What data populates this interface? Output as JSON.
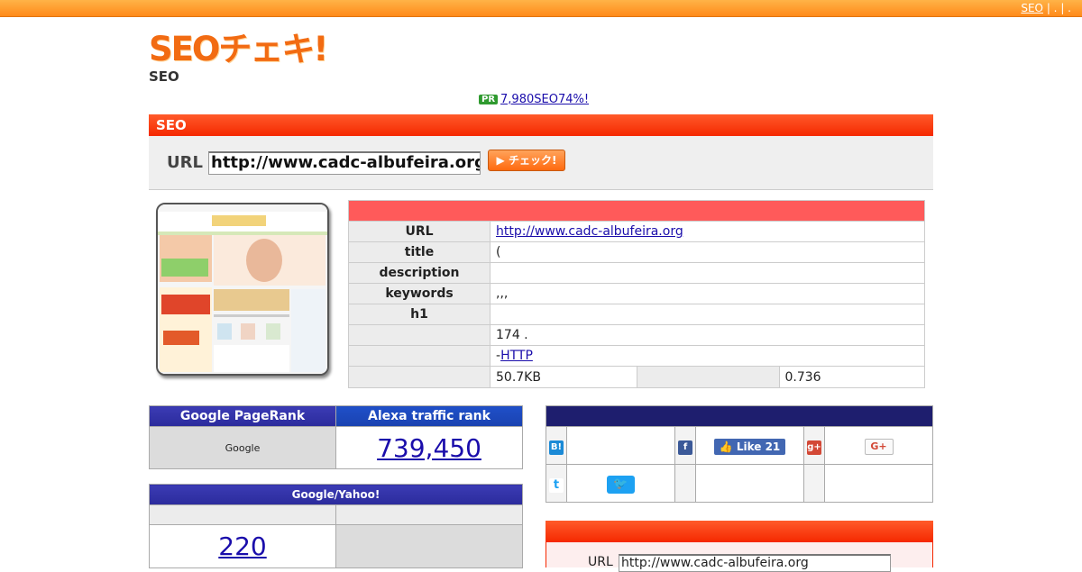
{
  "topbar": {
    "link1": "SEO",
    "link2": "| . | ."
  },
  "logo": {
    "text": "SEOチェキ!",
    "subtitle": "SEO"
  },
  "promo": {
    "badge": "PR",
    "link": "7,980SEO74%!"
  },
  "seo_section": {
    "title": "SEO",
    "url_label": "URL",
    "url_value": "http://www.cadc-albufeira.org",
    "check_button": "チェック!"
  },
  "info": {
    "url_label": "URL",
    "url_value": "http://www.cadc-albufeira.org",
    "title_label": "title",
    "title_value": "(",
    "description_label": "description",
    "description_value": "",
    "keywords_label": "keywords",
    "keywords_value": ",,,",
    "h1_label": "h1",
    "h1_value": "",
    "row6_value": "174        .",
    "row7_prefix": "-",
    "row7_link": "HTTP",
    "size_value": "50.7KB",
    "time_value": "0.736"
  },
  "ranks": {
    "pagerank_header": "Google PageRank",
    "alexa_header": "Alexa traffic rank",
    "pagerank_value": "Google",
    "alexa_value": "739,450"
  },
  "index": {
    "header": "Google/Yahoo!",
    "google_value": "220"
  },
  "social": {
    "hatena_icon": "B!",
    "facebook_icon": "f",
    "gplus_icon": "g+",
    "twitter_icon": "t",
    "like_label": "Like 21",
    "gplus_button": "G+"
  },
  "bottom": {
    "url_label": "URL",
    "url_value": "http://www.cadc-albufeira.org"
  },
  "colors": {
    "orange": "#ff8a1a",
    "red": "#f52800",
    "navy": "#2b2b9c"
  }
}
